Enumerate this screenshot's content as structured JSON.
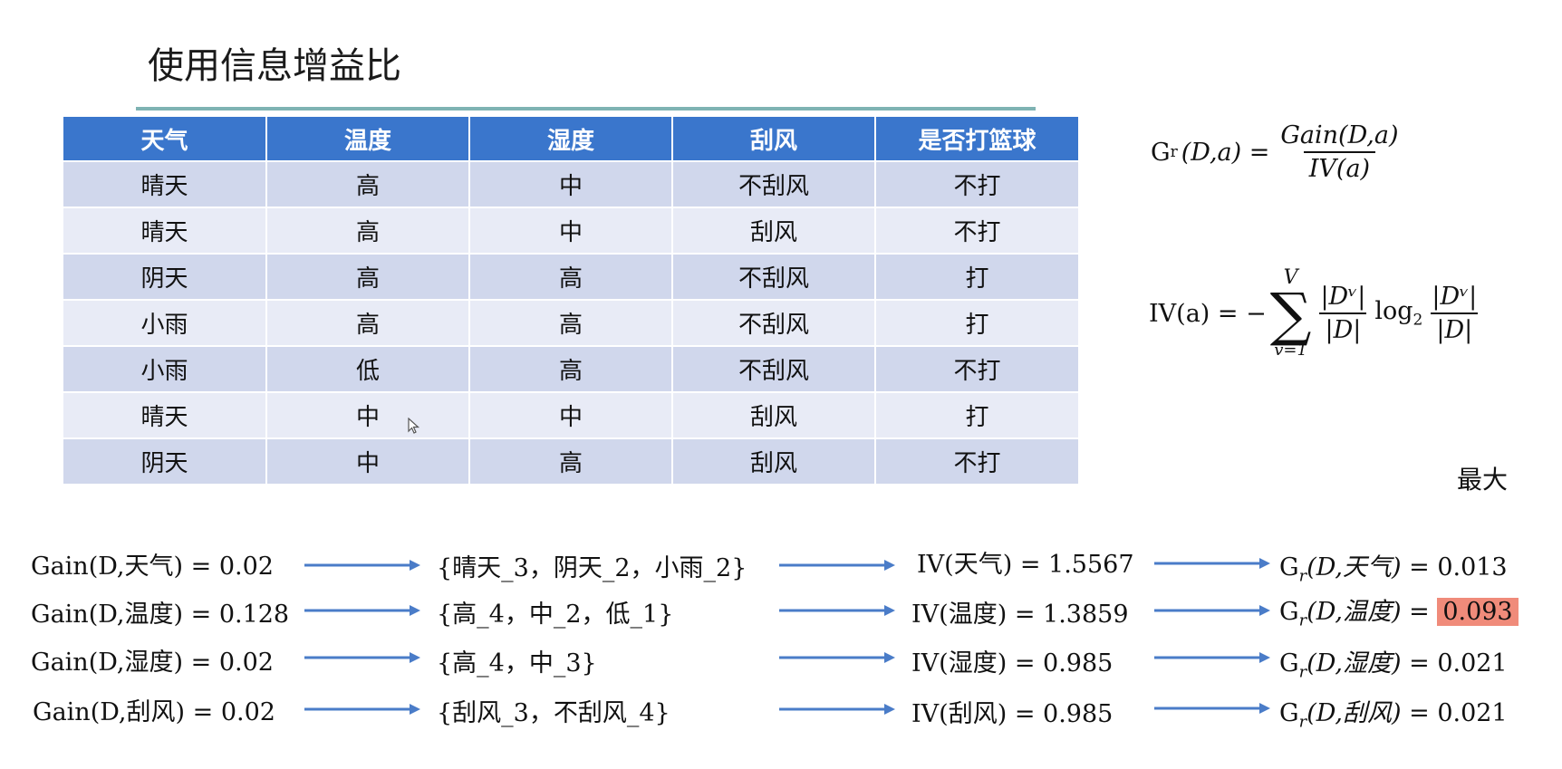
{
  "title": "使用信息增益比",
  "table": {
    "headers": [
      "天气",
      "温度",
      "湿度",
      "刮风",
      "是否打篮球"
    ],
    "rows": [
      [
        "晴天",
        "高",
        "中",
        "不刮风",
        "不打"
      ],
      [
        "晴天",
        "高",
        "中",
        "刮风",
        "不打"
      ],
      [
        "阴天",
        "高",
        "高",
        "不刮风",
        "打"
      ],
      [
        "小雨",
        "高",
        "高",
        "不刮风",
        "打"
      ],
      [
        "小雨",
        "低",
        "高",
        "不刮风",
        "不打"
      ],
      [
        "晴天",
        "中",
        "中",
        "刮风",
        "打"
      ],
      [
        "阴天",
        "中",
        "高",
        "刮风",
        "不打"
      ]
    ]
  },
  "formulas": {
    "gr_left": "G",
    "gr_sub": "r",
    "gr_args": "(D,a) =",
    "gr_num": "Gain(D,a)",
    "gr_den": "IV(a)",
    "iv_left": "IV(a) = −",
    "iv_top": "V",
    "iv_sigma": "∑",
    "iv_bottom": "v=1",
    "iv_num1": "|Dᵛ|",
    "iv_den1": "|D|",
    "iv_log": "log",
    "iv_log_sub": "2",
    "iv_num2": "|Dᵛ|",
    "iv_den2": "|D|"
  },
  "max_label": "最大",
  "calc_rows": [
    {
      "gain": "Gain(D,天气) = 0.02",
      "split": "{晴天_3，阴天_2，小雨_2}",
      "iv": "IV(天气) = 1.5567",
      "gr_prefix": "G",
      "gr_sub": "r",
      "gr_body": "(D,天气) = ",
      "gr_value": "0.013"
    },
    {
      "gain": "Gain(D,温度) = 0.128",
      "split": "{高_4，中_2，低_1}",
      "iv": "IV(温度) = 1.3859",
      "gr_prefix": "G",
      "gr_sub": "r",
      "gr_body": "(D,温度) = ",
      "gr_value": "0.093"
    },
    {
      "gain": "Gain(D,湿度) = 0.02",
      "split": "{高_4，中_3}",
      "iv": "IV(湿度) = 0.985",
      "gr_prefix": "G",
      "gr_sub": "r",
      "gr_body": "(D,湿度) = ",
      "gr_value": "0.021"
    },
    {
      "gain": "Gain(D,刮风) = 0.02",
      "split": "{刮风_3，不刮风_4}",
      "iv": "IV(刮风) = 0.985",
      "gr_prefix": "G",
      "gr_sub": "r",
      "gr_body": "(D,刮风) = ",
      "gr_value": "0.021"
    }
  ],
  "colors": {
    "header_bg": "#3a76cc",
    "row_odd": "#d0d7ec",
    "row_even": "#e8ebf6",
    "arrow": "#4a7cc8",
    "highlight": "#f08b7a",
    "title_rule": "#7fb3b3"
  },
  "icons": {
    "cursor": "mouse-pointer-icon",
    "arrow": "arrow-right-icon"
  }
}
